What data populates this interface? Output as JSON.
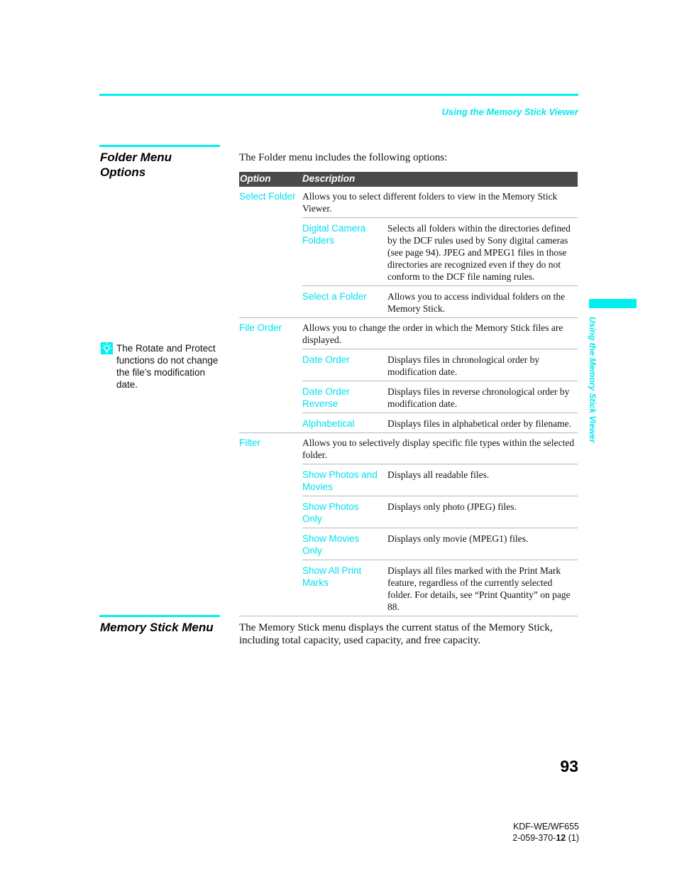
{
  "header": {
    "running_head": "Using the Memory Stick Viewer"
  },
  "side_tab": {
    "label": "Using the Memory Stick Viewer"
  },
  "sections": {
    "folder_menu": {
      "title_line1": "Folder Menu",
      "title_line2": "Options",
      "intro": "The Folder menu includes the following options:"
    },
    "memory_stick_menu": {
      "title": "Memory Stick Menu",
      "body": "The Memory Stick menu displays the current status of the Memory Stick, including total capacity, used capacity, and free capacity."
    }
  },
  "tip": {
    "icon": "lightbulb-icon",
    "text": "The Rotate and Protect functions do not change the file’s modification date."
  },
  "table": {
    "headers": {
      "option": "Option",
      "description": "Description"
    },
    "groups": [
      {
        "option": "Select Folder",
        "description": "Allows you to select different folders to view in the Memory Stick Viewer.",
        "sub_options": [
          {
            "option": "Digital Camera Folders",
            "description": "Selects all folders within the directories defined by the DCF rules used by Sony digital cameras (see page 94). JPEG and MPEG1 files in those directories are recognized even if they do not conform to the DCF file naming rules."
          },
          {
            "option": "Select a Folder",
            "description": "Allows you to access individual folders on the Memory Stick."
          }
        ]
      },
      {
        "option": "File Order",
        "description": "Allows you to change the order in which the Memory Stick files are displayed.",
        "sub_options": [
          {
            "option": "Date Order",
            "description": "Displays files in chronological order by modification date."
          },
          {
            "option": "Date Order Reverse",
            "description": "Displays files in reverse chronological order by modification date."
          },
          {
            "option": "Alphabetical",
            "description": "Displays files in alphabetical order by filename."
          }
        ]
      },
      {
        "option": "Filter",
        "description": "Allows you to selectively display specific file types within the selected folder.",
        "sub_options": [
          {
            "option": "Show Photos and Movies",
            "description": "Displays all readable files."
          },
          {
            "option": "Show Photos Only",
            "description": "Displays only photo (JPEG) files."
          },
          {
            "option": "Show Movies Only",
            "description": "Displays only movie (MPEG1) files."
          },
          {
            "option": "Show All Print Marks",
            "description": "Displays all files marked with the Print Mark feature, regardless of the currently selected folder. For details, see “Print Quantity” on page 88."
          }
        ]
      }
    ]
  },
  "footer": {
    "page_number": "93",
    "model": "KDF-WE/WF655",
    "doc_code_prefix": "2-059-370-",
    "doc_code_bold": "12",
    "doc_code_suffix": " (1)"
  },
  "colors": {
    "accent_cyan": "#00f0f0",
    "table_header_bg": "#4a4a4a",
    "divider": "#b8b8b8"
  }
}
